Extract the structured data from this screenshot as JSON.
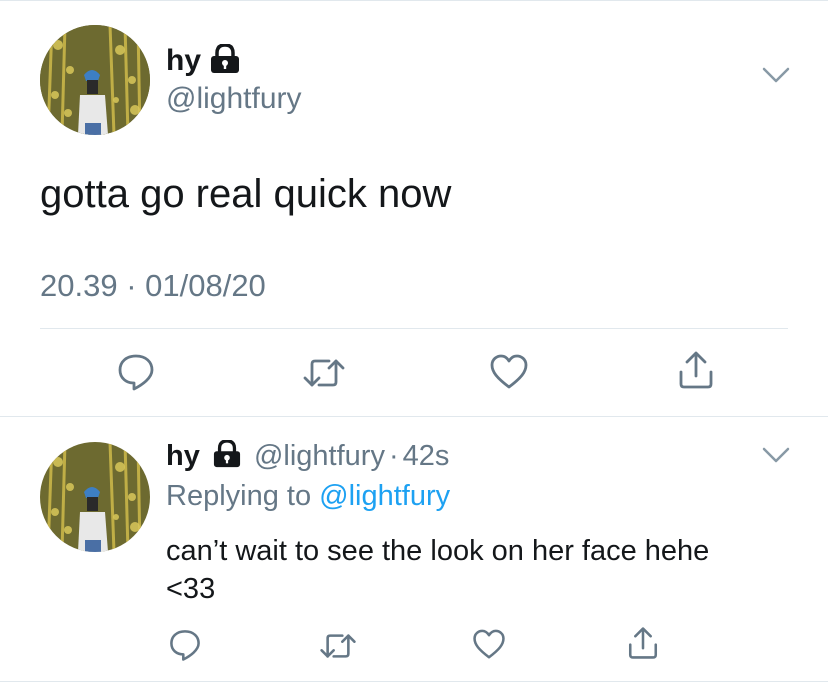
{
  "main_tweet": {
    "display_name": "hy",
    "handle": "@lightfury",
    "text": "gotta go real quick now",
    "timestamp": "20.39 · 01/08/20",
    "protected": true
  },
  "reply_tweet": {
    "display_name": "hy",
    "handle": "@lightfury",
    "separator": "·",
    "time_ago": "42s",
    "replying_prefix": "Replying to",
    "replying_handle": "@lightfury",
    "text_line1": "can’t wait to see the look on her face hehe",
    "text_line2": "<33",
    "protected": true
  },
  "icons": {
    "reply": "comment-icon",
    "retweet": "retweet-icon",
    "like": "heart-icon",
    "share": "share-icon",
    "menu": "chevron-down-icon",
    "protected": "lock-icon"
  },
  "colors": {
    "text": "#14171a",
    "secondary": "#657786",
    "link": "#1da1f2",
    "divider": "#e1e8ed"
  }
}
